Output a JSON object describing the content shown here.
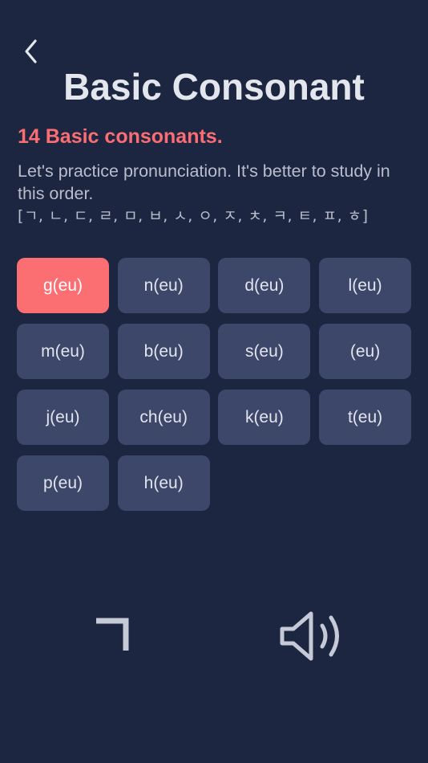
{
  "header": {
    "back_icon": "chevron-left-icon",
    "title": "Basic Consonant"
  },
  "intro": {
    "subtitle": "14 Basic consonants.",
    "description": "Let's practice pronunciation. It's better to study in this order.",
    "order": "[ㄱ, ㄴ, ㄷ, ㄹ, ㅁ, ㅂ, ㅅ, ㅇ, ㅈ, ㅊ, ㅋ, ㅌ, ㅍ, ㅎ]"
  },
  "consonants": [
    {
      "label": "g(eu)",
      "selected": true
    },
    {
      "label": "n(eu)",
      "selected": false
    },
    {
      "label": "d(eu)",
      "selected": false
    },
    {
      "label": "l(eu)",
      "selected": false
    },
    {
      "label": "m(eu)",
      "selected": false
    },
    {
      "label": "b(eu)",
      "selected": false
    },
    {
      "label": "s(eu)",
      "selected": false
    },
    {
      "label": "(eu)",
      "selected": false
    },
    {
      "label": "j(eu)",
      "selected": false
    },
    {
      "label": "ch(eu)",
      "selected": false
    },
    {
      "label": "k(eu)",
      "selected": false
    },
    {
      "label": "t(eu)",
      "selected": false
    },
    {
      "label": "p(eu)",
      "selected": false
    },
    {
      "label": "h(eu)",
      "selected": false
    }
  ],
  "display": {
    "glyph": "ㄱ",
    "speaker_icon": "speaker-volume-icon"
  },
  "colors": {
    "background": "#1d2640",
    "key": "#3c4769",
    "accent": "#fb6f73",
    "text": "#e4e6ee",
    "muted_text": "#b9bdcd",
    "icon": "#c6c9d6"
  }
}
